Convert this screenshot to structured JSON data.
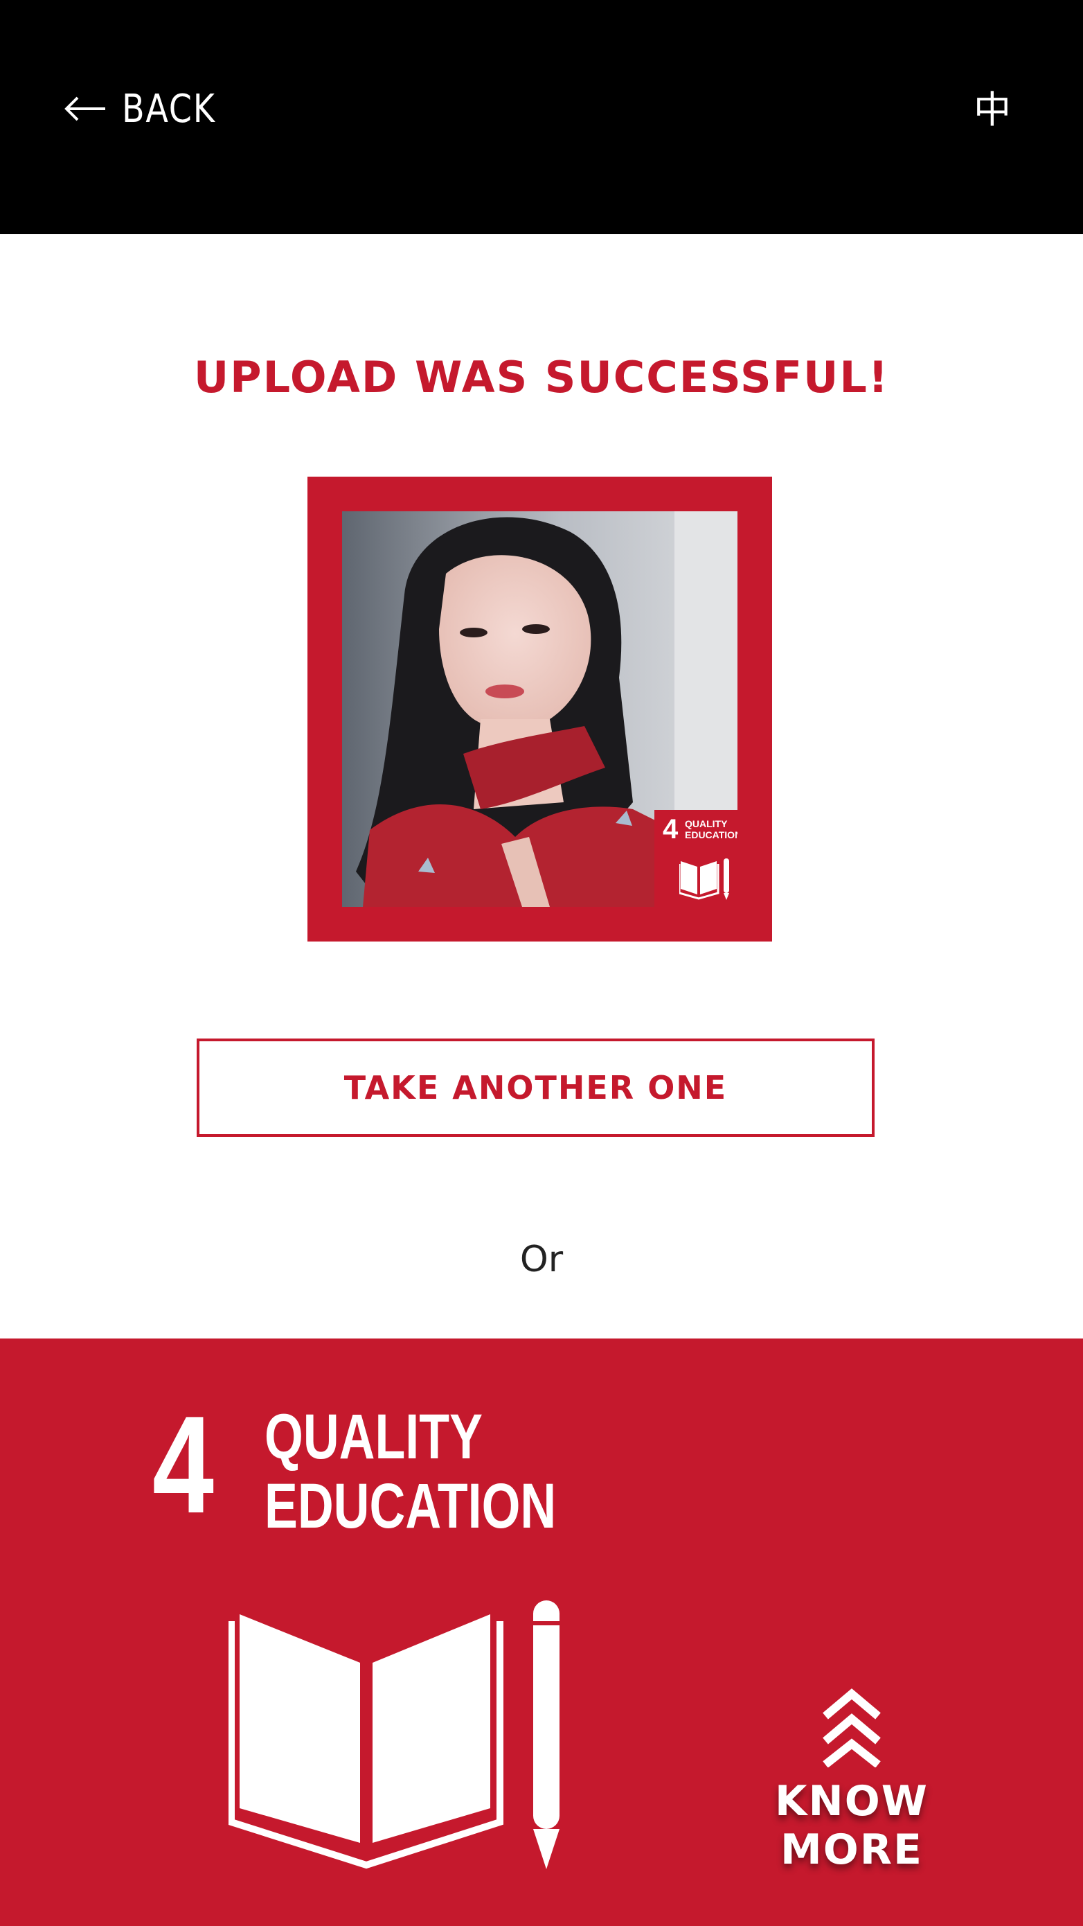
{
  "header": {
    "back_label": "BACK",
    "language_toggle": "中"
  },
  "main": {
    "title": "UPLOAD WAS SUCCESSFUL!",
    "photo_badge": {
      "number": "4",
      "text": "QUALITY\nEDUCATION"
    },
    "take_another_label": "TAKE ANOTHER ONE",
    "or_text": "Or"
  },
  "sdg": {
    "number": "4",
    "title_line1": "QUALITY",
    "title_line2": "EDUCATION",
    "know_more_label": "KNOW MORE"
  },
  "colors": {
    "brand_red": "#c5192d",
    "header_bg": "#000000",
    "page_bg": "#ffffff"
  },
  "icons": {
    "back": "arrow-left-icon",
    "sdg": "book-and-pencil-icon",
    "know_more": "double-chevron-up-icon"
  }
}
